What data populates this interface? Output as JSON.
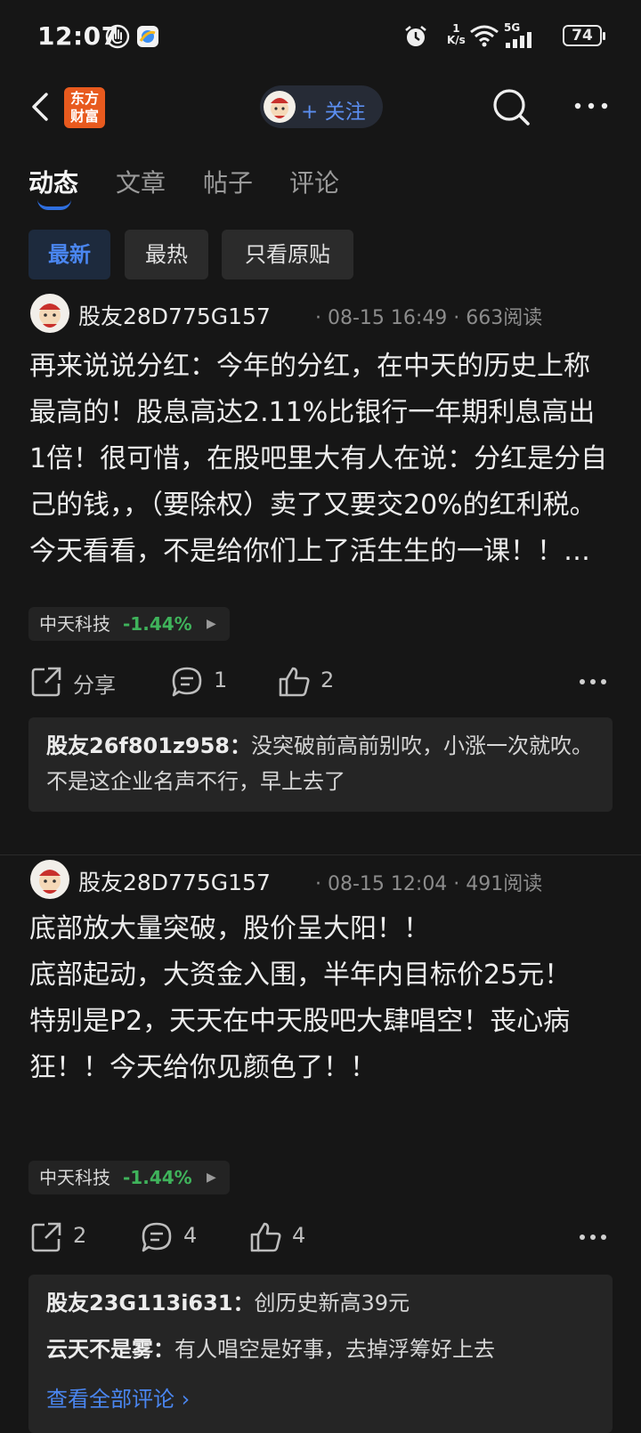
{
  "status_bar": {
    "time": "12:07",
    "net_speed_value": "1",
    "net_speed_unit": "K/s",
    "network": "5G",
    "battery": "74"
  },
  "nav": {
    "logo_text": "东方财富",
    "logo_line1": "东方",
    "logo_line2": "财富",
    "follow_label": "+ 关注"
  },
  "tabs": [
    {
      "label": "动态",
      "active": true
    },
    {
      "label": "文章",
      "active": false
    },
    {
      "label": "帖子",
      "active": false
    },
    {
      "label": "评论",
      "active": false
    }
  ],
  "filters": [
    {
      "label": "最新",
      "active": true
    },
    {
      "label": "最热",
      "active": false
    },
    {
      "label": "只看原贴",
      "active": false
    }
  ],
  "colors": {
    "accent": "#2f6fe0",
    "link": "#4a86f0",
    "stock_down": "#3fb35b",
    "background": "#161616",
    "logo": "#e85a1e"
  },
  "posts": [
    {
      "user": "股友28D775G157",
      "meta": "· 08-15 16:49 · 663阅读",
      "body": "再来说说分红：今年的分红，在中天的历史上称最高的！股息高达2.11%比银行一年期利息高出1倍！很可惜，在股吧里大有人在说：分红是分自己的钱，，（要除权）卖了又要交20%的红利税。今天看看，不是给你们上了活生生的一课！！…",
      "stock_name": "中天科技",
      "stock_change": "-1.44%",
      "share_label": "分享",
      "comment_count": "1",
      "like_count": "2",
      "comments": [
        {
          "user": "股友26f801z958：",
          "text": "没突破前高前别吹，小涨一次就吹。不是这企业名声不行，早上去了"
        }
      ]
    },
    {
      "user": "股友28D775G157",
      "meta": "· 08-15 12:04 · 491阅读",
      "body": "底部放大量突破，股价呈大阳！！\n底部起动，大资金入围，半年内目标价25元！\n特别是P2，天天在中天股吧大肆唱空！丧心病狂！！今天给你见颜色了！！",
      "stock_name": "中天科技",
      "stock_change": "-1.44%",
      "share_count": "2",
      "comment_count": "4",
      "like_count": "4",
      "comments": [
        {
          "user": "股友23G113i631：",
          "text": "创历史新高39元"
        },
        {
          "user": "云天不是雾：",
          "text": "有人唱空是好事，去掉浮筹好上去"
        }
      ],
      "view_all_label": "查看全部评论 ›"
    }
  ]
}
